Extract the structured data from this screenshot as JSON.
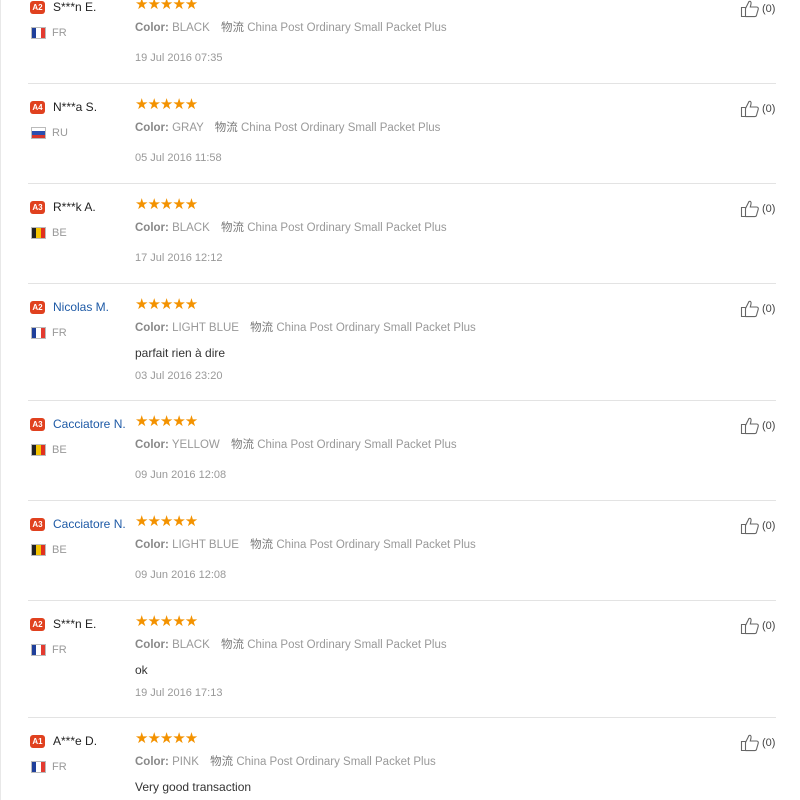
{
  "reviews": [
    {
      "level": "A2",
      "level_color": "#e0411f",
      "name": "S***n E.",
      "name_style": "anon",
      "country": "FR",
      "flag": "fr",
      "stars": "★★★★★",
      "color_label": "Color:",
      "color_value": "BLACK",
      "ship_icon": "物流",
      "shipping": "China Post Ordinary Small Packet Plus",
      "comment": "",
      "date": "19 Jul 2016 07:35",
      "helpful_count": "(0)"
    },
    {
      "level": "A4",
      "level_color": "#e0411f",
      "name": "N***a S.",
      "name_style": "anon",
      "country": "RU",
      "flag": "ru",
      "stars": "★★★★★",
      "color_label": "Color:",
      "color_value": "GRAY",
      "ship_icon": "物流",
      "shipping": "China Post Ordinary Small Packet Plus",
      "comment": "",
      "date": "05 Jul 2016 11:58",
      "helpful_count": "(0)"
    },
    {
      "level": "A3",
      "level_color": "#e0411f",
      "name": "R***k A.",
      "name_style": "anon",
      "country": "BE",
      "flag": "be",
      "stars": "★★★★★",
      "color_label": "Color:",
      "color_value": "BLACK",
      "ship_icon": "物流",
      "shipping": "China Post Ordinary Small Packet Plus",
      "comment": "",
      "date": "17 Jul 2016 12:12",
      "helpful_count": "(0)"
    },
    {
      "level": "A2",
      "level_color": "#e0411f",
      "name": "Nicolas M.",
      "name_style": "link",
      "country": "FR",
      "flag": "fr",
      "stars": "★★★★★",
      "color_label": "Color:",
      "color_value": "LIGHT BLUE",
      "ship_icon": "物流",
      "shipping": "China Post Ordinary Small Packet Plus",
      "comment": "parfait rien à dire",
      "date": "03 Jul 2016 23:20",
      "helpful_count": "(0)"
    },
    {
      "level": "A3",
      "level_color": "#e0411f",
      "name": "Cacciatore N.",
      "name_style": "link",
      "country": "BE",
      "flag": "be",
      "stars": "★★★★★",
      "color_label": "Color:",
      "color_value": "YELLOW",
      "ship_icon": "物流",
      "shipping": "China Post Ordinary Small Packet Plus",
      "comment": "",
      "date": "09 Jun 2016 12:08",
      "helpful_count": "(0)"
    },
    {
      "level": "A3",
      "level_color": "#e0411f",
      "name": "Cacciatore N.",
      "name_style": "link",
      "country": "BE",
      "flag": "be",
      "stars": "★★★★★",
      "color_label": "Color:",
      "color_value": "LIGHT BLUE",
      "ship_icon": "物流",
      "shipping": "China Post Ordinary Small Packet Plus",
      "comment": "",
      "date": "09 Jun 2016 12:08",
      "helpful_count": "(0)"
    },
    {
      "level": "A2",
      "level_color": "#e0411f",
      "name": "S***n E.",
      "name_style": "anon",
      "country": "FR",
      "flag": "fr",
      "stars": "★★★★★",
      "color_label": "Color:",
      "color_value": "BLACK",
      "ship_icon": "物流",
      "shipping": "China Post Ordinary Small Packet Plus",
      "comment": "ok",
      "date": "19 Jul 2016 17:13",
      "helpful_count": "(0)"
    },
    {
      "level": "A1",
      "level_color": "#e0411f",
      "name": "A***e D.",
      "name_style": "anon",
      "country": "FR",
      "flag": "fr",
      "stars": "★★★★★",
      "color_label": "Color:",
      "color_value": "PINK",
      "ship_icon": "物流",
      "shipping": "China Post Ordinary Small Packet Plus",
      "comment": "Very good transaction",
      "date": "",
      "helpful_count": "(0)"
    }
  ]
}
